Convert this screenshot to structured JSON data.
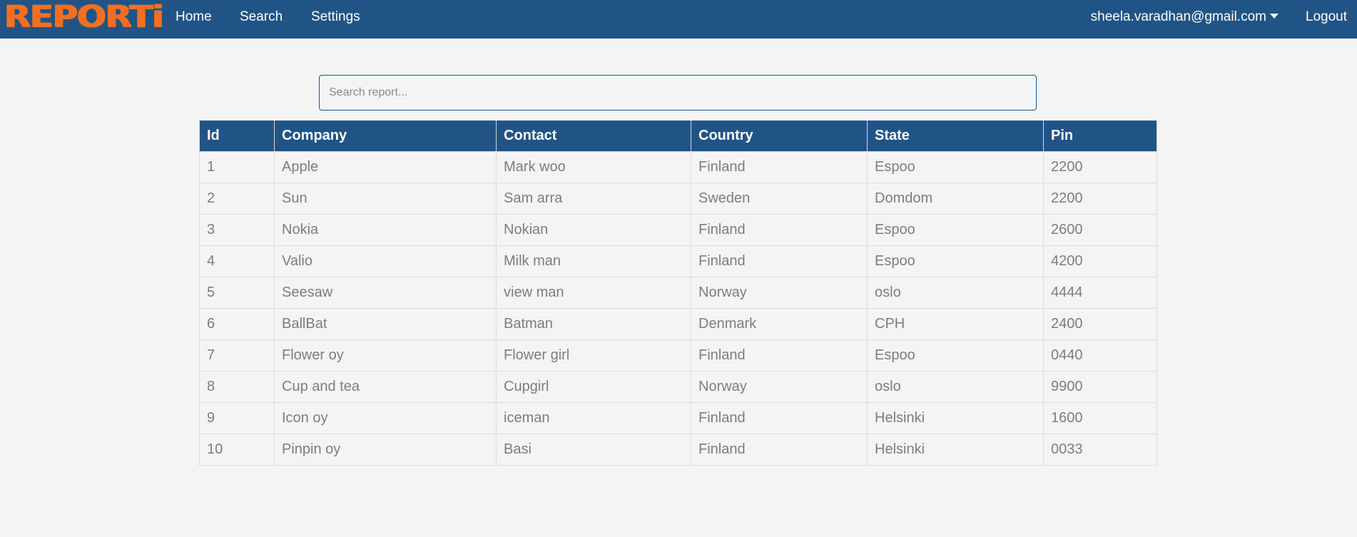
{
  "app": {
    "logo": "REPORTi",
    "accent_color": "#215486",
    "logo_color": "#f26f21"
  },
  "nav": {
    "home": "Home",
    "search": "Search",
    "settings": "Settings",
    "user": "sheela.varadhan@gmail.com",
    "logout": "Logout"
  },
  "search": {
    "placeholder": "Search report...",
    "value": ""
  },
  "table": {
    "headers": {
      "id": "Id",
      "company": "Company",
      "contact": "Contact",
      "country": "Country",
      "state": "State",
      "pin": "Pin"
    },
    "rows": [
      {
        "id": "1",
        "company": "Apple",
        "contact": "Mark woo",
        "country": "Finland",
        "state": "Espoo",
        "pin": "2200"
      },
      {
        "id": "2",
        "company": "Sun",
        "contact": "Sam arra",
        "country": "Sweden",
        "state": "Domdom",
        "pin": "2200"
      },
      {
        "id": "3",
        "company": "Nokia",
        "contact": "Nokian",
        "country": "Finland",
        "state": "Espoo",
        "pin": "2600"
      },
      {
        "id": "4",
        "company": "Valio",
        "contact": "Milk man",
        "country": "Finland",
        "state": "Espoo",
        "pin": "4200"
      },
      {
        "id": "5",
        "company": "Seesaw",
        "contact": "view man",
        "country": "Norway",
        "state": "oslo",
        "pin": "4444"
      },
      {
        "id": "6",
        "company": "BallBat",
        "contact": "Batman",
        "country": "Denmark",
        "state": "CPH",
        "pin": "2400"
      },
      {
        "id": "7",
        "company": "Flower oy",
        "contact": "Flower girl",
        "country": "Finland",
        "state": "Espoo",
        "pin": "0440"
      },
      {
        "id": "8",
        "company": "Cup and tea",
        "contact": "Cupgirl",
        "country": "Norway",
        "state": "oslo",
        "pin": "9900"
      },
      {
        "id": "9",
        "company": "Icon oy",
        "contact": "iceman",
        "country": "Finland",
        "state": "Helsinki",
        "pin": "1600"
      },
      {
        "id": "10",
        "company": "Pinpin oy",
        "contact": "Basi",
        "country": "Finland",
        "state": "Helsinki",
        "pin": "0033"
      }
    ]
  }
}
